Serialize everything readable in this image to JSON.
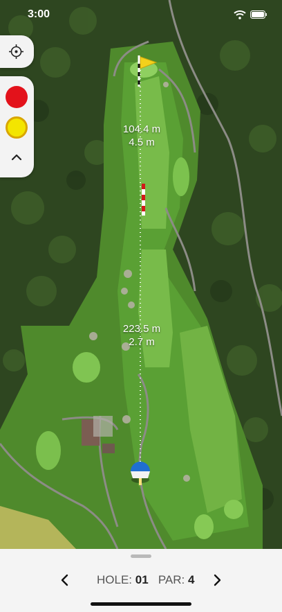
{
  "status_bar": {
    "time": "3:00"
  },
  "map": {
    "distance_upper": {
      "meters": "104.4 m",
      "elevation": "4.5 m"
    },
    "distance_lower": {
      "meters": "223.5 m",
      "elevation": "2.7 m"
    }
  },
  "colors": {
    "marker_red": "#e3121b",
    "marker_yellow": "#f3e500"
  },
  "bottom_bar": {
    "hole_label": "HOLE:",
    "hole_value": "01",
    "par_label": "PAR:",
    "par_value": "4"
  }
}
